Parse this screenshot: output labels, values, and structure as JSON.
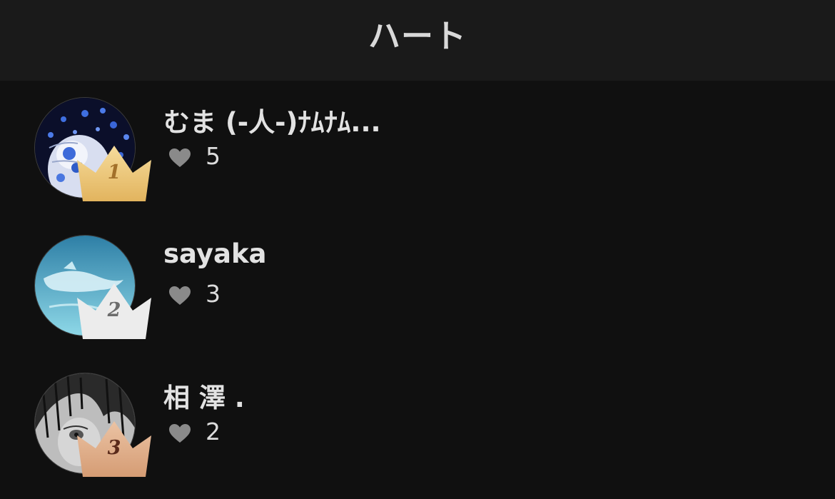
{
  "header": {
    "title": "ハート"
  },
  "colors": {
    "background": "#101010",
    "header_background": "#1a1a1a",
    "crown_gold": "#eac47a",
    "crown_silver": "#e9e9e9",
    "crown_bronze": "#dcac8a",
    "heart": "#8a8a8a"
  },
  "ranking": [
    {
      "rank": "1",
      "name": "むま (-人-)ﾅﾑﾅﾑ...",
      "hearts": "5",
      "crown": "gold-crown-icon"
    },
    {
      "rank": "2",
      "name": "sayaka",
      "hearts": "3",
      "crown": "silver-crown-icon"
    },
    {
      "rank": "3",
      "name": "相 澤 .",
      "hearts": "2",
      "crown": "bronze-crown-icon"
    }
  ]
}
